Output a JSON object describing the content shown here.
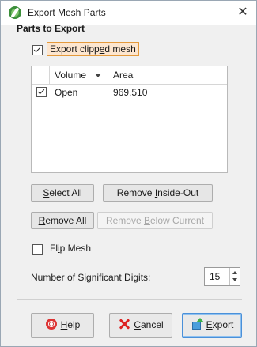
{
  "window": {
    "title": "Export Mesh Parts",
    "close_glyph": "✕"
  },
  "parts": {
    "section_title": "Parts to Export",
    "export_clipped": {
      "label_pre": "Export clipp",
      "label_u": "e",
      "label_post": "d mesh",
      "checked": true
    },
    "table": {
      "columns": [
        "Volume",
        "Area"
      ],
      "rows": [
        {
          "checked": true,
          "volume": "Open",
          "area": "969,510"
        }
      ]
    }
  },
  "buttons": {
    "select_all": {
      "pre": "",
      "u": "S",
      "post": "elect All"
    },
    "remove_inside_out": {
      "pre": "Remove ",
      "u": "I",
      "post": "nside-Out"
    },
    "remove_all": {
      "pre": "",
      "u": "R",
      "post": "emove All"
    },
    "remove_below_current": {
      "pre": "Remove ",
      "u": "B",
      "post": "elow Current"
    }
  },
  "flip_mesh": {
    "pre": "Fl",
    "u": "i",
    "post": "p Mesh",
    "checked": false
  },
  "significant_digits": {
    "label": "Number of Significant Digits:",
    "value": "15"
  },
  "footer": {
    "help": {
      "pre": "",
      "u": "H",
      "post": "elp"
    },
    "cancel": {
      "pre": "",
      "u": "C",
      "post": "ancel"
    },
    "export": {
      "pre": "",
      "u": "E",
      "post": "xport"
    }
  },
  "colors": {
    "focus_orange": "#e49a3c",
    "default_blue": "#4a90d9"
  }
}
